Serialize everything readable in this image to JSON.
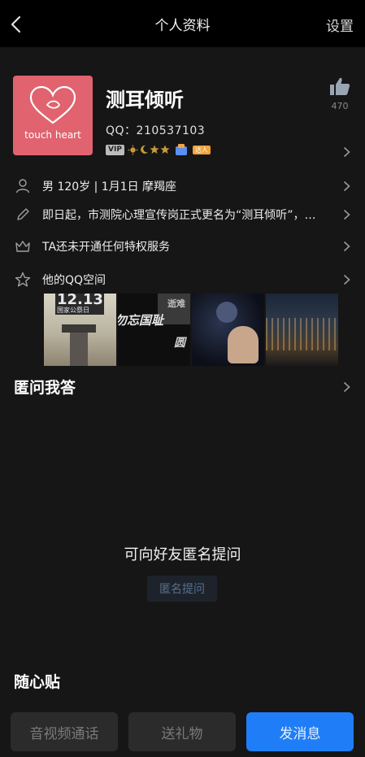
{
  "header": {
    "title": "个人资料",
    "settings": "设置"
  },
  "profile": {
    "avatar_text": "touch heart",
    "nickname": "测耳倾听",
    "qq": "QQ：210537103",
    "vip_label": "VIP",
    "tag_label": "达人",
    "likes": "470"
  },
  "rows": {
    "basic": "男  120岁  |  1月1日  摩羯座",
    "signature": "即日起，市测院心理宣传岗正式更名为“测耳倾听”，…",
    "privilege": "TA还未开通任何特权服务",
    "qzone": "他的QQ空间"
  },
  "photos": {
    "p1_line1": "12.13",
    "p1_line2": "国家公祭日",
    "p2_line1": "勿忘国耻",
    "p2_corner": "逝难",
    "p2_side": "圆"
  },
  "anon": {
    "title": "匿问我答",
    "empty_text": "可向好友匿名提问",
    "ask_button": "匿名提问"
  },
  "suixin": {
    "title": "随心贴"
  },
  "bottom": {
    "call": "音视频通话",
    "gift": "送礼物",
    "message": "发消息"
  },
  "colors": {
    "accent": "#1f7ef7",
    "avatar_bg": "#e0636f",
    "background": "#161616"
  }
}
